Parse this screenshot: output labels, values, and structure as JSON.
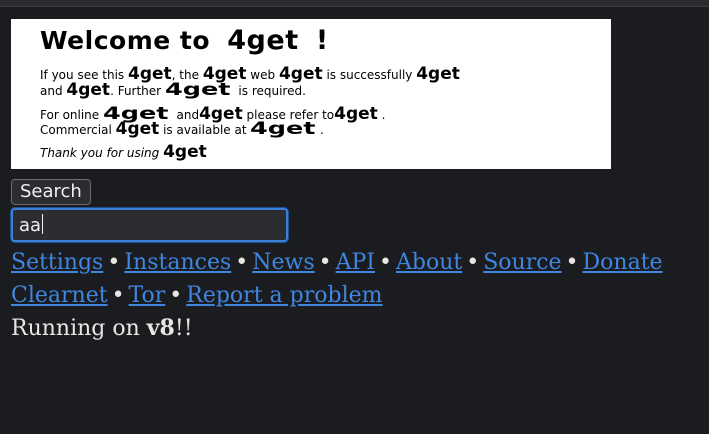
{
  "logo": {
    "title_prefix": "Welcome to",
    "title_brand": "4get",
    "title_suffix": "!",
    "line2": [
      "If you see this",
      "4get",
      ", the",
      "4get",
      "web",
      "4get",
      "is successfully",
      "4get"
    ],
    "line3": [
      "and",
      "4get",
      ". Further",
      "4get",
      "is required."
    ],
    "line4": [
      "For online",
      "4get",
      "and",
      "4get",
      "please refer to",
      "4get",
      "."
    ],
    "line5": [
      "Commercial",
      "4get",
      "is available at",
      "4get",
      "."
    ],
    "line6": [
      "Thank you for using",
      "4get"
    ]
  },
  "search": {
    "button_label": "Search",
    "input_value": "aa"
  },
  "links_row1": [
    "Settings",
    "Instances",
    "News",
    "API",
    "About",
    "Source",
    "Donate"
  ],
  "links_row2": [
    "Clearnet",
    "Tor",
    "Report a problem"
  ],
  "separator": "•",
  "running": {
    "prefix": "Running on ",
    "version": "v8",
    "suffix": "!!"
  },
  "colors": {
    "background": "#1b1c1f",
    "link": "#3f86e0",
    "focus_ring": "#3b7fd8"
  }
}
